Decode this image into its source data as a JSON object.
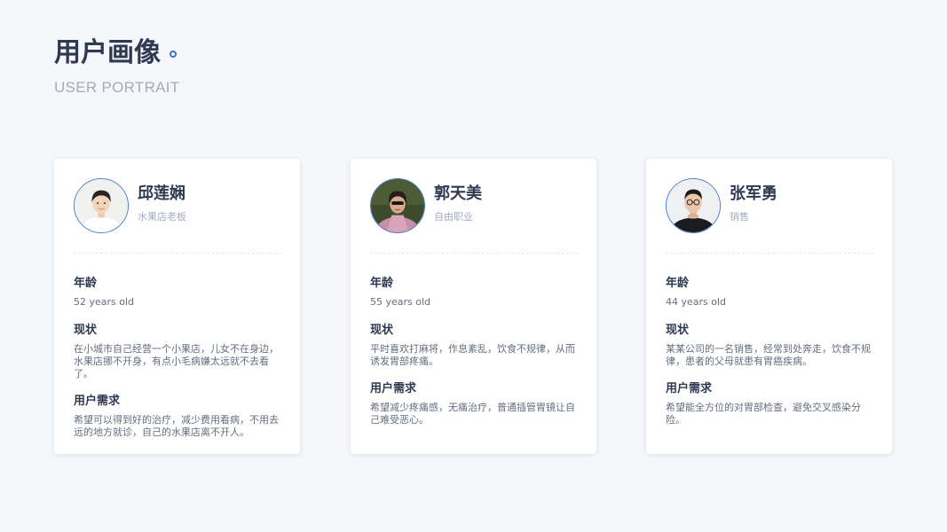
{
  "header": {
    "title": "用户画像",
    "subtitle": "USER PORTRAIT"
  },
  "colors": {
    "accent": "#3b6fd0",
    "title_text": "#2f3a52",
    "muted_text": "#a3abc4",
    "body_text": "#666d7e",
    "background": "#f5f7fb"
  },
  "labels": {
    "age": "年龄",
    "status": "现状",
    "needs": "用户需求"
  },
  "personas": [
    {
      "name": "邱莲娴",
      "role": "水果店老板",
      "age": "52 years old",
      "status": "在小城市自己经营一个小果店，儿女不在身边，水果店挪不开身，有点小毛病嫌太远就不去看了。",
      "needs": "希望可以得到好的治疗，减少费用看病，不用去远的地方就诊，自己的水果店离不开人。"
    },
    {
      "name": "郭天美",
      "role": "自由职业",
      "age": "55 years old",
      "status": "平时喜欢打麻将，作息紊乱，饮食不规律，从而诱发胃部疼痛。",
      "needs": "希望减少疼痛感，无痛治疗，普通插管胃镜让自己难受恶心。"
    },
    {
      "name": "张军勇",
      "role": "销售",
      "age": "44 years old",
      "status": "某某公司的一名销售，经常到处奔走，饮食不规律，患者的父母就患有胃癌疾病。",
      "needs": "希望能全方位的对胃部检查，避免交叉感染分险。"
    }
  ]
}
